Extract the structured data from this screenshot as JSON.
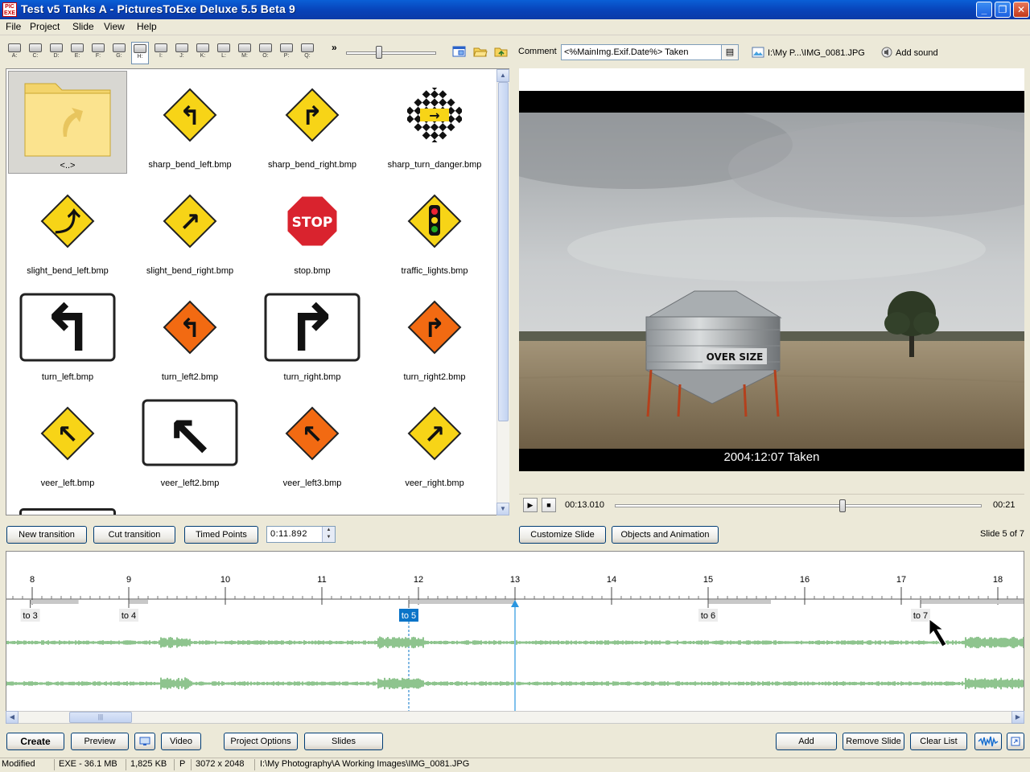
{
  "window": {
    "title": "Test v5 Tanks A - PicturesToExe Deluxe 5.5 Beta 9",
    "icon_text": "PIC EXE"
  },
  "menu": [
    "File",
    "Project",
    "Slide",
    "View",
    "Help"
  ],
  "toolbar": {
    "drives": [
      "A:",
      "C:",
      "D:",
      "E:",
      "F:",
      "G:",
      "H:",
      "I:",
      "J:",
      "K:",
      "L:",
      "M:",
      "O:",
      "P:",
      "Q:"
    ],
    "active_drive": "H:",
    "more": "»",
    "comment_label": "Comment",
    "comment_value": "<%MainImg.Exif.Date%> Taken",
    "file_path": "I:\\My P...\\IMG_0081.JPG",
    "add_sound": "Add sound"
  },
  "browser": {
    "items": [
      {
        "name": "<..>",
        "kind": "folder"
      },
      {
        "name": "sharp_bend_left.bmp",
        "kind": "sign-diamond",
        "glyph": "↰"
      },
      {
        "name": "sharp_bend_right.bmp",
        "kind": "sign-diamond",
        "glyph": "↱"
      },
      {
        "name": "sharp_turn_danger.bmp",
        "kind": "sign-checker",
        "glyph": "→"
      },
      {
        "name": "slight_bend_left.bmp",
        "kind": "sign-diamond",
        "glyph": "⤴"
      },
      {
        "name": "slight_bend_right.bmp",
        "kind": "sign-diamond",
        "glyph": "↗"
      },
      {
        "name": "stop.bmp",
        "kind": "sign-stop",
        "glyph": "STOP"
      },
      {
        "name": "traffic_lights.bmp",
        "kind": "sign-lights",
        "glyph": ""
      },
      {
        "name": "turn_left.bmp",
        "kind": "sign-rect",
        "glyph": "↰"
      },
      {
        "name": "turn_left2.bmp",
        "kind": "sign-orange",
        "glyph": "↰"
      },
      {
        "name": "turn_right.bmp",
        "kind": "sign-rect",
        "glyph": "↱"
      },
      {
        "name": "turn_right2.bmp",
        "kind": "sign-orange",
        "glyph": "↱"
      },
      {
        "name": "veer_left.bmp",
        "kind": "sign-diamond",
        "glyph": "↖"
      },
      {
        "name": "veer_left2.bmp",
        "kind": "sign-rect",
        "glyph": "↖"
      },
      {
        "name": "veer_left3.bmp",
        "kind": "sign-orange",
        "glyph": "↖"
      },
      {
        "name": "veer_right.bmp",
        "kind": "sign-diamond",
        "glyph": "↗"
      }
    ]
  },
  "preview": {
    "caption": "2004:12:07 Taken",
    "sign_text": "OVER SIZE",
    "current_time": "00:13.010",
    "total_time": "00:21",
    "progress_fraction": 0.62
  },
  "controls": {
    "new_transition": "New transition",
    "cut_transition": "Cut transition",
    "timed_points": "Timed Points",
    "time_value": "0:11.892",
    "customize_slide": "Customize Slide",
    "objects_animation": "Objects and Animation",
    "slide_count": "Slide 5 of 7"
  },
  "timeline": {
    "seconds": [
      8,
      9,
      10,
      11,
      12,
      13,
      14,
      15,
      16,
      17,
      18
    ],
    "markers": [
      {
        "label": "to 3",
        "time": 7.98,
        "selected": false,
        "span_end": 8.48
      },
      {
        "label": "to 4",
        "time": 9.0,
        "selected": false,
        "span_end": 9.2
      },
      {
        "label": "to 5",
        "time": 11.9,
        "selected": true,
        "span_end": 13.0
      },
      {
        "label": "to 6",
        "time": 15.0,
        "selected": false,
        "span_end": 15.65
      },
      {
        "label": "to 7",
        "time": 17.2,
        "selected": false,
        "span_end": 18.3
      }
    ],
    "playhead": 13.0
  },
  "bottom_buttons": {
    "create": "Create",
    "preview": "Preview",
    "video": "Video",
    "project_options": "Project Options",
    "slides": "Slides",
    "add": "Add",
    "remove_slide": "Remove Slide",
    "clear_list": "Clear List"
  },
  "status": {
    "state": "Modified",
    "exe_size": "EXE - 36.1 MB",
    "file_size": "1,825 KB",
    "orientation": "P",
    "dimensions": "3072 x 2048",
    "path": "I:\\My Photography\\A Working Images\\IMG_0081.JPG"
  },
  "colors": {
    "accent": "#0a74c8",
    "waveform": "#1e8a1e",
    "timeline_bar": "#c8c8c8"
  }
}
